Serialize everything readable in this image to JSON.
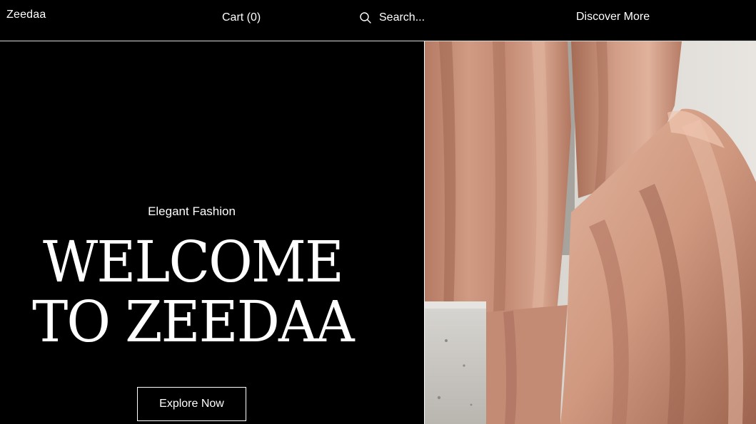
{
  "header": {
    "logo": "Zeedaa",
    "cart_label": "Cart (0)",
    "search_placeholder": "Search...",
    "discover_label": "Discover More"
  },
  "hero": {
    "eyebrow": "Elegant Fashion",
    "headline_line1": "WELCOME",
    "headline_line2": "TO ZEEDAA",
    "cta_label": "Explore Now",
    "image_description_icon": "fabric-photo"
  },
  "colors": {
    "background": "#000000",
    "text": "#ffffff",
    "fabric": "#c98f78",
    "fabric_shadow": "#8e5a47",
    "wall": "#e4e1dc"
  }
}
